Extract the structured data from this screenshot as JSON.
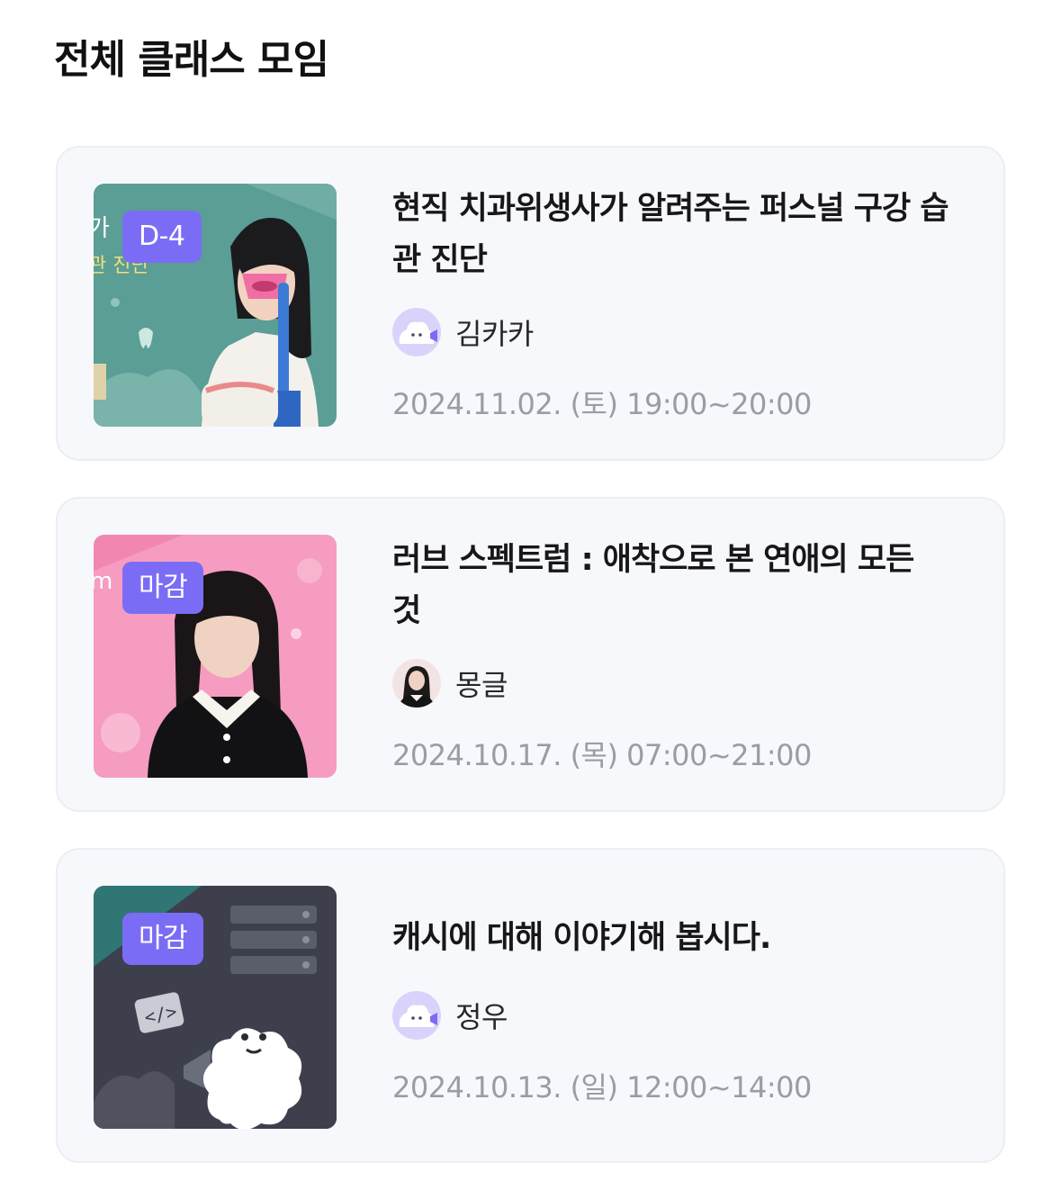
{
  "header": {
    "title": "전체 클래스 모임"
  },
  "classes": [
    {
      "badge": "D-4",
      "title": "현직 치과위생사가 알려주는 퍼스널 구강 습관 진단",
      "host": "김카카",
      "datetime": "2024.11.02. (토) 19:00~20:00",
      "thumbnail": "dental-hygienist-photo",
      "avatar_icon": "cloud-mascot-icon"
    },
    {
      "badge": "마감",
      "title": "러브 스펙트럼 : 애착으로 본 연애의 모든 것",
      "host": "몽글",
      "datetime": "2024.10.17. (목) 07:00~21:00",
      "thumbnail": "woman-portrait-pink",
      "avatar_icon": "woman-portrait-avatar"
    },
    {
      "badge": "마감",
      "title": "캐시에 대해 이야기해 봅시다.",
      "host": "정우",
      "datetime": "2024.10.13. (일) 12:00~14:00",
      "thumbnail": "server-mascot-illustration",
      "avatar_icon": "cloud-mascot-icon"
    }
  ],
  "colors": {
    "badge": "#7b6cf6",
    "card_bg": "#f7f8fb",
    "date_text": "#9a9ca6",
    "avatar_bg": "#d9d3fb"
  }
}
